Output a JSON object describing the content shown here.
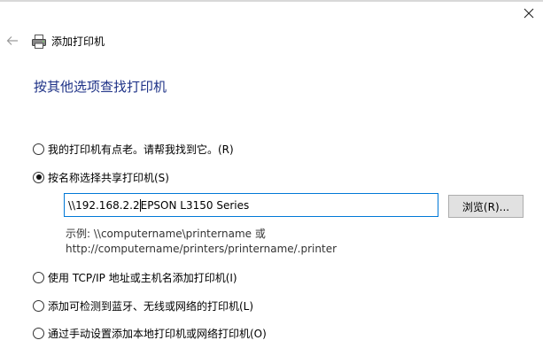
{
  "window": {
    "title": "添加打印机",
    "close_glyph": "✕",
    "back_glyph": "←"
  },
  "page": {
    "heading": "按其他选项查找打印机"
  },
  "options": [
    {
      "label": "我的打印机有点老。请帮我找到它。(R)",
      "selected": false
    },
    {
      "label": "按名称选择共享打印机(S)",
      "selected": true
    },
    {
      "label": "使用 TCP/IP 地址或主机名添加打印机(I)",
      "selected": false
    },
    {
      "label": "添加可检测到蓝牙、无线或网络的打印机(L)",
      "selected": false
    },
    {
      "label": "通过手动设置添加本地打印机或网络打印机(O)",
      "selected": false
    }
  ],
  "shared_printer": {
    "value_before_caret": "\\\\192.168.2.2",
    "value_after_caret": "EPSON L3150 Series",
    "browse_label": "浏览(R)...",
    "example_line1": "示例: \\\\computername\\printername 或",
    "example_line2": "http://computername/printers/printername/.printer"
  },
  "colors": {
    "heading": "#1e3287",
    "input_border": "#0078d7"
  }
}
